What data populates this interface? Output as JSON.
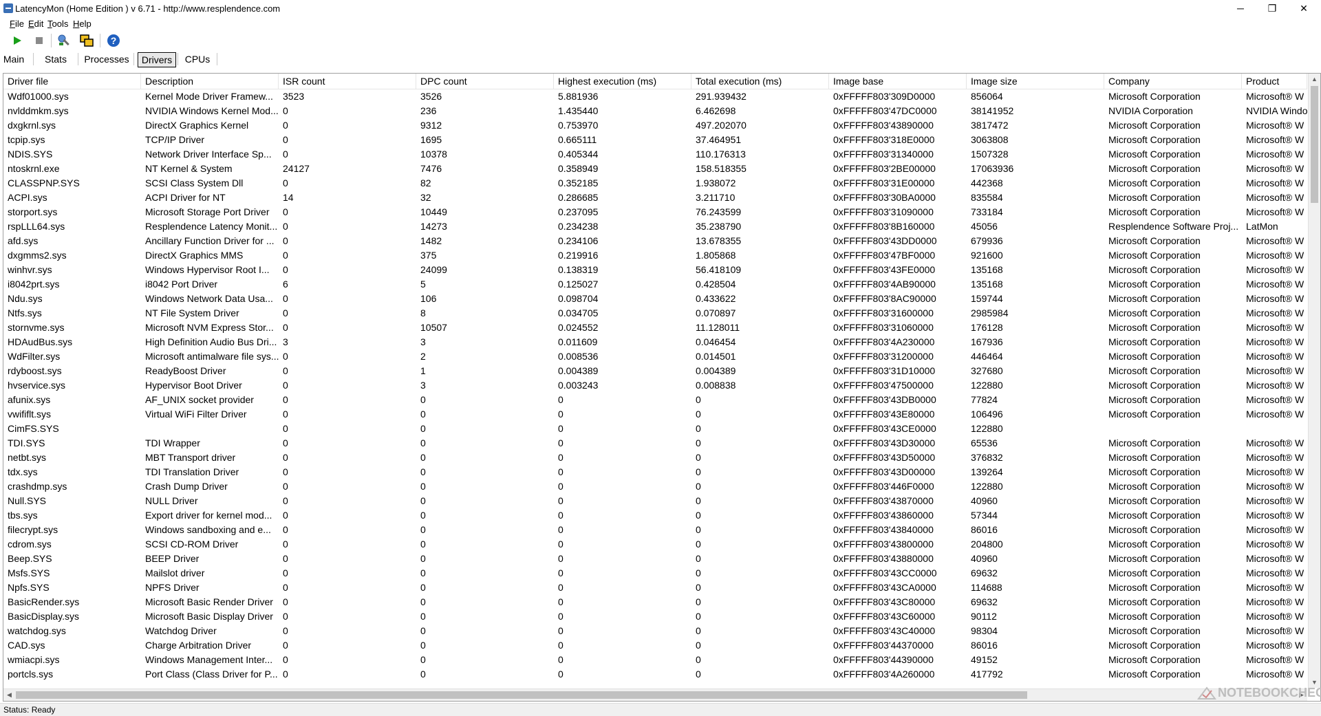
{
  "window": {
    "title": "LatencyMon  (Home Edition )  v 6.71 - http://www.resplendence.com",
    "minimize_glyph": "─",
    "maximize_glyph": "❐",
    "close_glyph": "✕"
  },
  "menu": [
    {
      "mnemonic": "F",
      "rest": "ile"
    },
    {
      "mnemonic": "E",
      "rest": "dit"
    },
    {
      "mnemonic": "T",
      "rest": "ools"
    },
    {
      "mnemonic": "H",
      "rest": "elp"
    }
  ],
  "toolbar": {
    "icons": [
      "play-icon",
      "stop-icon",
      "tools-icon",
      "windows-icon",
      "help-icon"
    ],
    "colors": {
      "play": "#1aa01a",
      "stop": "#8a8a8a",
      "help": "#1f5fbf"
    }
  },
  "tabs": [
    "Main",
    "Stats",
    "Processes",
    "Drivers",
    "CPUs"
  ],
  "active_tab": "Drivers",
  "columns": [
    "Driver file",
    "Description",
    "ISR count",
    "DPC count",
    "Highest execution (ms)",
    "Total execution (ms)",
    "Image base",
    "Image size",
    "Company",
    "Product"
  ],
  "rows": [
    [
      "Wdf01000.sys",
      "Kernel Mode Driver Framew...",
      "3523",
      "3526",
      "5.881936",
      "291.939432",
      "0xFFFFF803'309D0000",
      "856064",
      "Microsoft Corporation",
      "Microsoft® W"
    ],
    [
      "nvlddmkm.sys",
      "NVIDIA Windows Kernel Mod...",
      "0",
      "236",
      "1.435440",
      "6.462698",
      "0xFFFFF803'47DC0000",
      "38141952",
      "NVIDIA Corporation",
      "NVIDIA Windo"
    ],
    [
      "dxgkrnl.sys",
      "DirectX Graphics Kernel",
      "0",
      "9312",
      "0.753970",
      "497.202070",
      "0xFFFFF803'43890000",
      "3817472",
      "Microsoft Corporation",
      "Microsoft® W"
    ],
    [
      "tcpip.sys",
      "TCP/IP Driver",
      "0",
      "1695",
      "0.665111",
      "37.464951",
      "0xFFFFF803'318E0000",
      "3063808",
      "Microsoft Corporation",
      "Microsoft® W"
    ],
    [
      "NDIS.SYS",
      "Network Driver Interface Sp...",
      "0",
      "10378",
      "0.405344",
      "110.176313",
      "0xFFFFF803'31340000",
      "1507328",
      "Microsoft Corporation",
      "Microsoft® W"
    ],
    [
      "ntoskrnl.exe",
      "NT Kernel & System",
      "24127",
      "7476",
      "0.358949",
      "158.518355",
      "0xFFFFF803'2BE00000",
      "17063936",
      "Microsoft Corporation",
      "Microsoft® W"
    ],
    [
      "CLASSPNP.SYS",
      "SCSI Class System Dll",
      "0",
      "82",
      "0.352185",
      "1.938072",
      "0xFFFFF803'31E00000",
      "442368",
      "Microsoft Corporation",
      "Microsoft® W"
    ],
    [
      "ACPI.sys",
      "ACPI Driver for NT",
      "14",
      "32",
      "0.286685",
      "3.211710",
      "0xFFFFF803'30BA0000",
      "835584",
      "Microsoft Corporation",
      "Microsoft® W"
    ],
    [
      "storport.sys",
      "Microsoft Storage Port Driver",
      "0",
      "10449",
      "0.237095",
      "76.243599",
      "0xFFFFF803'31090000",
      "733184",
      "Microsoft Corporation",
      "Microsoft® W"
    ],
    [
      "rspLLL64.sys",
      "Resplendence Latency Monit...",
      "0",
      "14273",
      "0.234238",
      "35.238790",
      "0xFFFFF803'8B160000",
      "45056",
      "Resplendence Software Proj...",
      "LatMon"
    ],
    [
      "afd.sys",
      "Ancillary Function Driver for ...",
      "0",
      "1482",
      "0.234106",
      "13.678355",
      "0xFFFFF803'43DD0000",
      "679936",
      "Microsoft Corporation",
      "Microsoft® W"
    ],
    [
      "dxgmms2.sys",
      "DirectX Graphics MMS",
      "0",
      "375",
      "0.219916",
      "1.805868",
      "0xFFFFF803'47BF0000",
      "921600",
      "Microsoft Corporation",
      "Microsoft® W"
    ],
    [
      "winhvr.sys",
      "Windows Hypervisor Root I...",
      "0",
      "24099",
      "0.138319",
      "56.418109",
      "0xFFFFF803'43FE0000",
      "135168",
      "Microsoft Corporation",
      "Microsoft® W"
    ],
    [
      "i8042prt.sys",
      "i8042 Port Driver",
      "6",
      "5",
      "0.125027",
      "0.428504",
      "0xFFFFF803'4AB90000",
      "135168",
      "Microsoft Corporation",
      "Microsoft® W"
    ],
    [
      "Ndu.sys",
      "Windows Network Data Usa...",
      "0",
      "106",
      "0.098704",
      "0.433622",
      "0xFFFFF803'8AC90000",
      "159744",
      "Microsoft Corporation",
      "Microsoft® W"
    ],
    [
      "Ntfs.sys",
      "NT File System Driver",
      "0",
      "8",
      "0.034705",
      "0.070897",
      "0xFFFFF803'31600000",
      "2985984",
      "Microsoft Corporation",
      "Microsoft® W"
    ],
    [
      "stornvme.sys",
      "Microsoft NVM Express Stor...",
      "0",
      "10507",
      "0.024552",
      "11.128011",
      "0xFFFFF803'31060000",
      "176128",
      "Microsoft Corporation",
      "Microsoft® W"
    ],
    [
      "HDAudBus.sys",
      "High Definition Audio Bus Dri...",
      "3",
      "3",
      "0.011609",
      "0.046454",
      "0xFFFFF803'4A230000",
      "167936",
      "Microsoft Corporation",
      "Microsoft® W"
    ],
    [
      "WdFilter.sys",
      "Microsoft antimalware file sys...",
      "0",
      "2",
      "0.008536",
      "0.014501",
      "0xFFFFF803'31200000",
      "446464",
      "Microsoft Corporation",
      "Microsoft® W"
    ],
    [
      "rdyboost.sys",
      "ReadyBoost Driver",
      "0",
      "1",
      "0.004389",
      "0.004389",
      "0xFFFFF803'31D10000",
      "327680",
      "Microsoft Corporation",
      "Microsoft® W"
    ],
    [
      "hvservice.sys",
      "Hypervisor Boot Driver",
      "0",
      "3",
      "0.003243",
      "0.008838",
      "0xFFFFF803'47500000",
      "122880",
      "Microsoft Corporation",
      "Microsoft® W"
    ],
    [
      "afunix.sys",
      "AF_UNIX socket provider",
      "0",
      "0",
      "0",
      "0",
      "0xFFFFF803'43DB0000",
      "77824",
      "Microsoft Corporation",
      "Microsoft® W"
    ],
    [
      "vwififlt.sys",
      "Virtual WiFi Filter Driver",
      "0",
      "0",
      "0",
      "0",
      "0xFFFFF803'43E80000",
      "106496",
      "Microsoft Corporation",
      "Microsoft® W"
    ],
    [
      "CimFS.SYS",
      "",
      "0",
      "0",
      "0",
      "0",
      "0xFFFFF803'43CE0000",
      "122880",
      "",
      ""
    ],
    [
      "TDI.SYS",
      "TDI Wrapper",
      "0",
      "0",
      "0",
      "0",
      "0xFFFFF803'43D30000",
      "65536",
      "Microsoft Corporation",
      "Microsoft® W"
    ],
    [
      "netbt.sys",
      "MBT Transport driver",
      "0",
      "0",
      "0",
      "0",
      "0xFFFFF803'43D50000",
      "376832",
      "Microsoft Corporation",
      "Microsoft® W"
    ],
    [
      "tdx.sys",
      "TDI Translation Driver",
      "0",
      "0",
      "0",
      "0",
      "0xFFFFF803'43D00000",
      "139264",
      "Microsoft Corporation",
      "Microsoft® W"
    ],
    [
      "crashdmp.sys",
      "Crash Dump Driver",
      "0",
      "0",
      "0",
      "0",
      "0xFFFFF803'446F0000",
      "122880",
      "Microsoft Corporation",
      "Microsoft® W"
    ],
    [
      "Null.SYS",
      "NULL Driver",
      "0",
      "0",
      "0",
      "0",
      "0xFFFFF803'43870000",
      "40960",
      "Microsoft Corporation",
      "Microsoft® W"
    ],
    [
      "tbs.sys",
      "Export driver for kernel mod...",
      "0",
      "0",
      "0",
      "0",
      "0xFFFFF803'43860000",
      "57344",
      "Microsoft Corporation",
      "Microsoft® W"
    ],
    [
      "filecrypt.sys",
      "Windows sandboxing and e...",
      "0",
      "0",
      "0",
      "0",
      "0xFFFFF803'43840000",
      "86016",
      "Microsoft Corporation",
      "Microsoft® W"
    ],
    [
      "cdrom.sys",
      "SCSI CD-ROM Driver",
      "0",
      "0",
      "0",
      "0",
      "0xFFFFF803'43800000",
      "204800",
      "Microsoft Corporation",
      "Microsoft® W"
    ],
    [
      "Beep.SYS",
      "BEEP Driver",
      "0",
      "0",
      "0",
      "0",
      "0xFFFFF803'43880000",
      "40960",
      "Microsoft Corporation",
      "Microsoft® W"
    ],
    [
      "Msfs.SYS",
      "Mailslot driver",
      "0",
      "0",
      "0",
      "0",
      "0xFFFFF803'43CC0000",
      "69632",
      "Microsoft Corporation",
      "Microsoft® W"
    ],
    [
      "Npfs.SYS",
      "NPFS Driver",
      "0",
      "0",
      "0",
      "0",
      "0xFFFFF803'43CA0000",
      "114688",
      "Microsoft Corporation",
      "Microsoft® W"
    ],
    [
      "BasicRender.sys",
      "Microsoft Basic Render Driver",
      "0",
      "0",
      "0",
      "0",
      "0xFFFFF803'43C80000",
      "69632",
      "Microsoft Corporation",
      "Microsoft® W"
    ],
    [
      "BasicDisplay.sys",
      "Microsoft Basic Display Driver",
      "0",
      "0",
      "0",
      "0",
      "0xFFFFF803'43C60000",
      "90112",
      "Microsoft Corporation",
      "Microsoft® W"
    ],
    [
      "watchdog.sys",
      "Watchdog Driver",
      "0",
      "0",
      "0",
      "0",
      "0xFFFFF803'43C40000",
      "98304",
      "Microsoft Corporation",
      "Microsoft® W"
    ],
    [
      "CAD.sys",
      "Charge Arbitration Driver",
      "0",
      "0",
      "0",
      "0",
      "0xFFFFF803'44370000",
      "86016",
      "Microsoft Corporation",
      "Microsoft® W"
    ],
    [
      "wmiacpi.sys",
      "Windows Management Inter...",
      "0",
      "0",
      "0",
      "0",
      "0xFFFFF803'44390000",
      "49152",
      "Microsoft Corporation",
      "Microsoft® W"
    ],
    [
      "portcls.sys",
      "Port Class (Class Driver for P...",
      "0",
      "0",
      "0",
      "0",
      "0xFFFFF803'4A260000",
      "417792",
      "Microsoft Corporation",
      "Microsoft® W"
    ]
  ],
  "status": "Status: Ready",
  "watermark": "NOTEBOOKCHECK"
}
